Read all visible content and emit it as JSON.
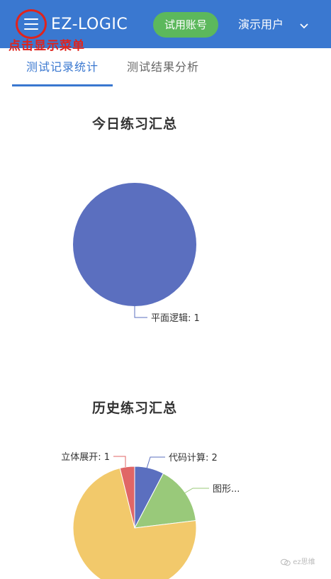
{
  "header": {
    "brand": "EZ-LOGIC",
    "trial_button": "试用账号",
    "user_menu": "演示用户",
    "annotation": "点击显示菜单",
    "accent_color": "#3a78d0"
  },
  "tabs": [
    {
      "label": "测试记录统计",
      "active": true
    },
    {
      "label": "测试结果分析",
      "active": false
    }
  ],
  "charts": {
    "today_title": "今日练习汇总",
    "history_title": "历史练习汇总"
  },
  "chart_data": [
    {
      "type": "pie",
      "title": "今日练习汇总",
      "slices": [
        {
          "label": "平面逻辑",
          "value": 1,
          "color": "#5b6fbf"
        }
      ],
      "data_labels": [
        "平面逻辑: 1"
      ]
    },
    {
      "type": "pie",
      "title": "历史练习汇总",
      "slices": [
        {
          "label": "代码计算",
          "value": 2,
          "color": "#5b6fbf"
        },
        {
          "label": "图形...",
          "value": 4,
          "color": "#99c97a"
        },
        {
          "label": "",
          "value": 19,
          "color": "#f2c96b"
        },
        {
          "label": "立体展开",
          "value": 1,
          "color": "#e06666"
        }
      ],
      "data_labels": [
        "代码计算: 2",
        "图形...",
        "立体展开: 1"
      ]
    }
  ],
  "watermark": "ez思维",
  "icons": {
    "menu": "hamburger-icon",
    "chevron": "chevron-down-icon",
    "watermark": "wechat-icon"
  }
}
